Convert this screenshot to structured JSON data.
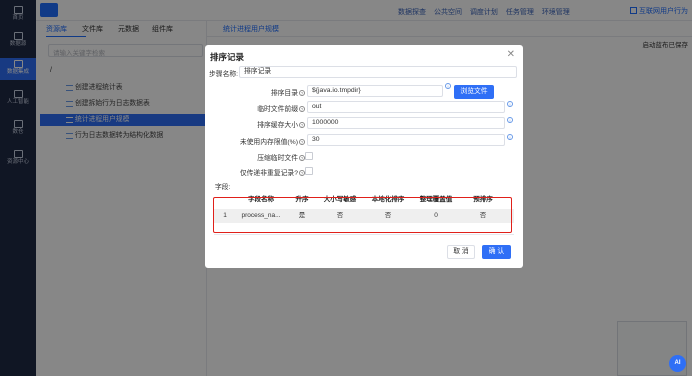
{
  "nav": {
    "items": [
      {
        "label": "首页",
        "icon": "home-icon"
      },
      {
        "label": "数据源",
        "icon": "database-icon"
      },
      {
        "label": "数据集成",
        "icon": "integration-icon"
      },
      {
        "label": "人工智能",
        "icon": "ai-icon"
      },
      {
        "label": "数仓",
        "icon": "warehouse-icon"
      },
      {
        "label": "资源中心",
        "icon": "resource-icon"
      }
    ]
  },
  "topbar": {
    "links": [
      "数据探查",
      "公共空间",
      "调度计划",
      "任务管理",
      "环境管理"
    ],
    "right": "互联网用户行为"
  },
  "panel": {
    "tabs": [
      "资源库",
      "文件库",
      "元数据",
      "组件库"
    ],
    "search_placeholder": "请输入关键字检索",
    "root": "/",
    "items": [
      "创建进程统计表",
      "创建拆始行为日志数据表",
      "统计进程用户规模",
      "行为日志数据转为结构化数据"
    ]
  },
  "workspace": {
    "tab": "统计进程用户规模",
    "right_label": "启动蓝布已保存"
  },
  "dialog": {
    "title": "排序记录",
    "step_name_label": "步骤名称:",
    "step_name_value": "排序记录",
    "sort_dir_label": "排序目录",
    "sort_dir_value": "${java.io.tmpdir}",
    "browse_label": "浏览文件",
    "tmp_prefix_label": "临时文件前缀",
    "tmp_prefix_value": "out",
    "cache_size_label": "排序缓存大小",
    "cache_size_value": "1000000",
    "mem_limit_label": "未使用内存限值(%)",
    "mem_limit_value": "30",
    "compress_label": "压缩临时文件",
    "dedupe_label": "仅传递非重复记录?",
    "fields_label": "字段:",
    "columns": [
      "字段名称",
      "升序",
      "大小写敏感",
      "本地化排序",
      "整理覆盖值",
      "预排序"
    ],
    "rows": [
      {
        "index": "1",
        "name": "process_na...",
        "asc": "是",
        "case": "否",
        "locale": "否",
        "collator": "0",
        "presort": "否"
      }
    ],
    "cancel_label": "取 消",
    "ok_label": "确 认"
  },
  "ai_label": "AI"
}
